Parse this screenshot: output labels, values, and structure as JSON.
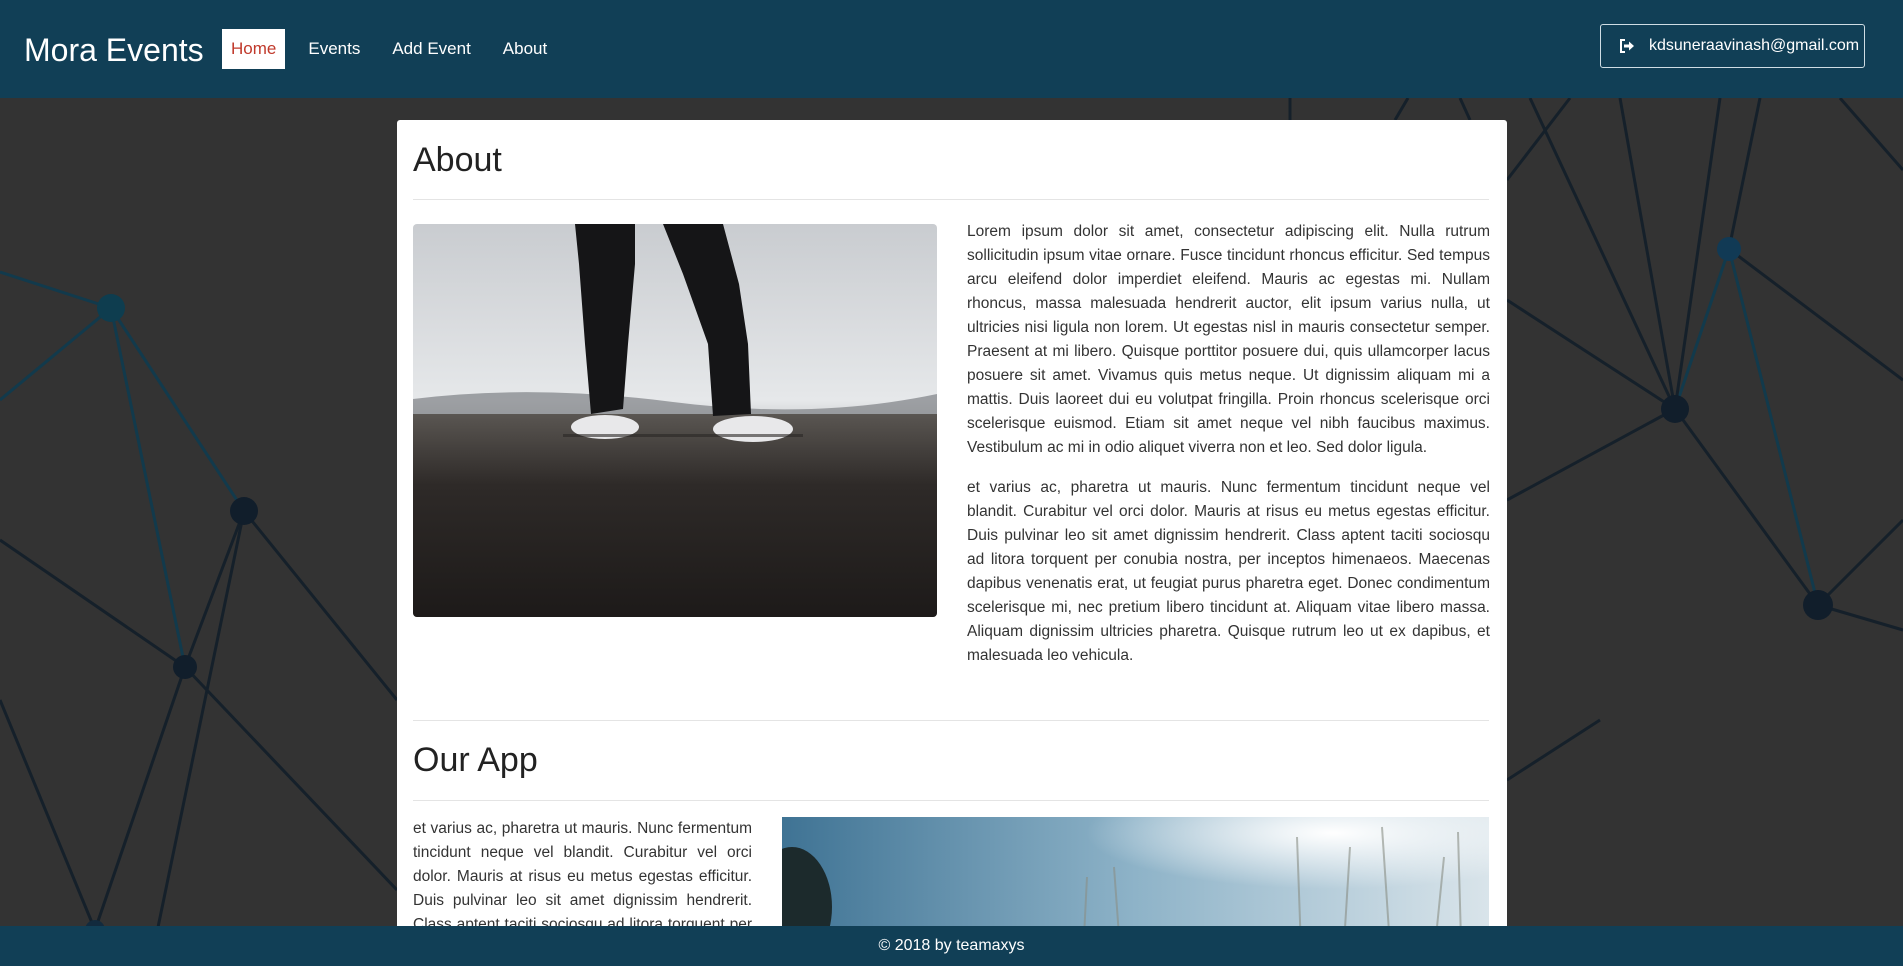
{
  "colors": {
    "navbar": "#113f56",
    "background": "#333333",
    "active_link": "#c0392b"
  },
  "nav": {
    "brand": "Mora Events",
    "links": [
      {
        "label": "Home",
        "active": true
      },
      {
        "label": "Events",
        "active": false
      },
      {
        "label": "Add Event",
        "active": false
      },
      {
        "label": "About",
        "active": false
      }
    ],
    "user": {
      "icon": "sign-out-icon",
      "email": "kdsuneraavinash@gmail.com"
    }
  },
  "about": {
    "title": "About",
    "image_alt": "person-standing-sneakers-photo",
    "paragraphs": [
      "Lorem ipsum dolor sit amet, consectetur adipiscing elit. Nulla rutrum sollicitudin ipsum vitae ornare. Fusce tincidunt rhoncus efficitur. Sed tempus arcu eleifend dolor imperdiet eleifend. Mauris ac egestas mi. Nullam rhoncus, massa malesuada hendrerit auctor, elit ipsum varius nulla, ut ultricies nisi ligula non lorem. Ut egestas nisl in mauris consectetur semper. Praesent at mi libero. Quisque porttitor posuere dui, quis ullamcorper lacus posuere sit amet. Vivamus quis metus neque. Ut dignissim aliquam mi a mattis. Duis laoreet dui eu volutpat fringilla. Proin rhoncus scelerisque orci scelerisque euismod. Etiam sit amet neque vel nibh faucibus maximus. Vestibulum ac mi in odio aliquet viverra non et leo. Sed dolor ligula.",
      "et varius ac, pharetra ut mauris. Nunc fermentum tincidunt neque vel blandit. Curabitur vel orci dolor. Mauris at risus eu metus egestas efficitur. Duis pulvinar leo sit amet dignissim hendrerit. Class aptent taciti sociosqu ad litora torquent per conubia nostra, per inceptos himenaeos. Maecenas dapibus venenatis erat, ut feugiat purus pharetra eget. Donec condimentum scelerisque mi, nec pretium libero tincidunt at. Aliquam vitae libero massa. Aliquam dignissim ultricies pharetra. Quisque rutrum leo ut ex dapibus, et malesuada leo vehicula."
    ]
  },
  "app": {
    "title": "Our App",
    "paragraph": "et varius ac, pharetra ut mauris. Nunc fermentum tincidunt neque vel blandit. Curabitur vel orci dolor. Mauris at risus eu metus egestas efficitur. Duis pulvinar leo sit amet dignissim hendrerit. Class aptent taciti sociosqu ad litora torquent per conubia nostra, per inceptos himenaeos.",
    "image_alt": "sunlit-grass-sky-photo"
  },
  "footer": {
    "text": "© 2018 by teamaxys"
  }
}
